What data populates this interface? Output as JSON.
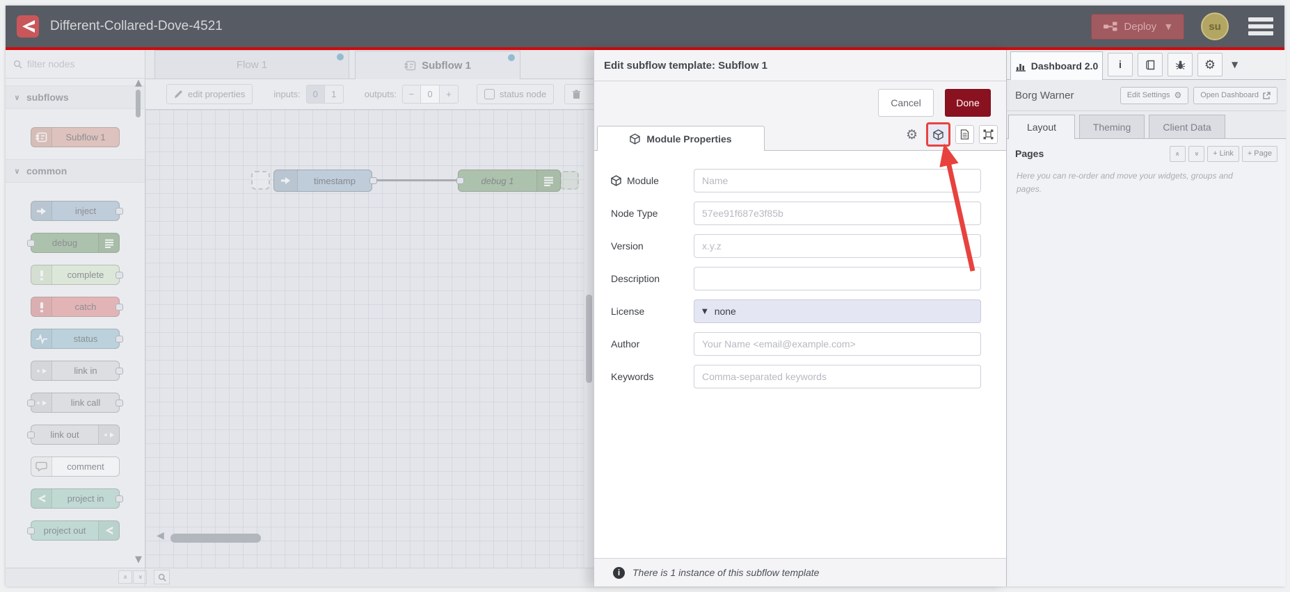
{
  "header": {
    "title": "Different-Collared-Dove-4521",
    "deploy_label": "Deploy",
    "avatar_text": "su"
  },
  "palette": {
    "search_placeholder": "filter nodes",
    "sections": [
      {
        "label": "subflows",
        "nodes": [
          {
            "label": "Subflow 1",
            "color": "#dbaa9e",
            "icon": "subflow",
            "icon_side": "left",
            "ports": "none"
          }
        ]
      },
      {
        "label": "common",
        "nodes": [
          {
            "label": "inject",
            "color": "#a6bbcf",
            "icon": "inject",
            "icon_side": "left",
            "ports": "right"
          },
          {
            "label": "debug",
            "color": "#87a980",
            "icon": "debug-list",
            "icon_side": "right",
            "ports": "left"
          },
          {
            "label": "complete",
            "color": "#d7e8cd",
            "icon": "bang",
            "icon_side": "left",
            "ports": "right"
          },
          {
            "label": "catch",
            "color": "#e49191",
            "icon": "bang",
            "icon_side": "left",
            "ports": "right"
          },
          {
            "label": "status",
            "color": "#9fc4d3",
            "icon": "pulse",
            "icon_side": "left",
            "ports": "right"
          },
          {
            "label": "link in",
            "color": "#d8d9db",
            "icon": "link",
            "icon_side": "left",
            "ports": "right"
          },
          {
            "label": "link call",
            "color": "#d8d9db",
            "icon": "link",
            "icon_side": "left",
            "ports": "both"
          },
          {
            "label": "link out",
            "color": "#d8d9db",
            "icon": "link",
            "icon_side": "right",
            "ports": "left"
          },
          {
            "label": "comment",
            "color": "#fbfbfc",
            "icon": "comment",
            "icon_side": "left",
            "ports": "none"
          },
          {
            "label": "project in",
            "color": "#a8d2c3",
            "icon": "logo",
            "icon_side": "left",
            "ports": "right"
          },
          {
            "label": "project out",
            "color": "#a8d2c3",
            "icon": "logo",
            "icon_side": "right",
            "ports": "left"
          }
        ]
      }
    ]
  },
  "tabs": [
    {
      "label": "Flow 1"
    },
    {
      "label": "Subflow 1"
    }
  ],
  "toolbar": {
    "edit_properties": "edit properties",
    "inputs_label": "inputs:",
    "inputs_options": [
      "0",
      "1"
    ],
    "inputs_selected": "0",
    "outputs_label": "outputs:",
    "outputs_minus": "−",
    "outputs_value": "0",
    "outputs_plus": "+",
    "status_node_label": "status node"
  },
  "canvas": {
    "nodes": [
      {
        "label": "timestamp"
      },
      {
        "label": "debug 1"
      }
    ]
  },
  "dialog": {
    "title": "Edit subflow template: Subflow 1",
    "cancel_label": "Cancel",
    "done_label": "Done",
    "tab_label": "Module Properties",
    "fields": [
      {
        "label": "Module",
        "icon": "cube",
        "control": "input",
        "placeholder": "Name"
      },
      {
        "label": "Node Type",
        "control": "input",
        "placeholder": "57ee91f687e3f85b"
      },
      {
        "label": "Version",
        "control": "input",
        "placeholder": "x.y.z"
      },
      {
        "label": "Description",
        "control": "input",
        "placeholder": ""
      },
      {
        "label": "License",
        "control": "select",
        "value": "none"
      },
      {
        "label": "Author",
        "control": "input",
        "placeholder": "Your Name <email@example.com>"
      },
      {
        "label": "Keywords",
        "control": "input",
        "placeholder": "Comma-separated keywords"
      }
    ],
    "footer_text": "There is 1 instance of this subflow template"
  },
  "sidebar": {
    "tab_label": "Dashboard 2.0",
    "owner": "Borg Warner",
    "edit_settings_label": "Edit Settings",
    "open_dashboard_label": "Open Dashboard",
    "subtabs": [
      "Layout",
      "Theming",
      "Client Data"
    ],
    "pages_label": "Pages",
    "link_button": "+ Link",
    "page_button": "+ Page",
    "help_text": "Here you can re-order and move your widgets, groups and pages."
  },
  "colors": {
    "accent_red": "#cf0b0d",
    "deploy_red": "#8a1220",
    "highlight_red": "#e8423e",
    "tab_dot_blue": "#5b9fc0"
  }
}
